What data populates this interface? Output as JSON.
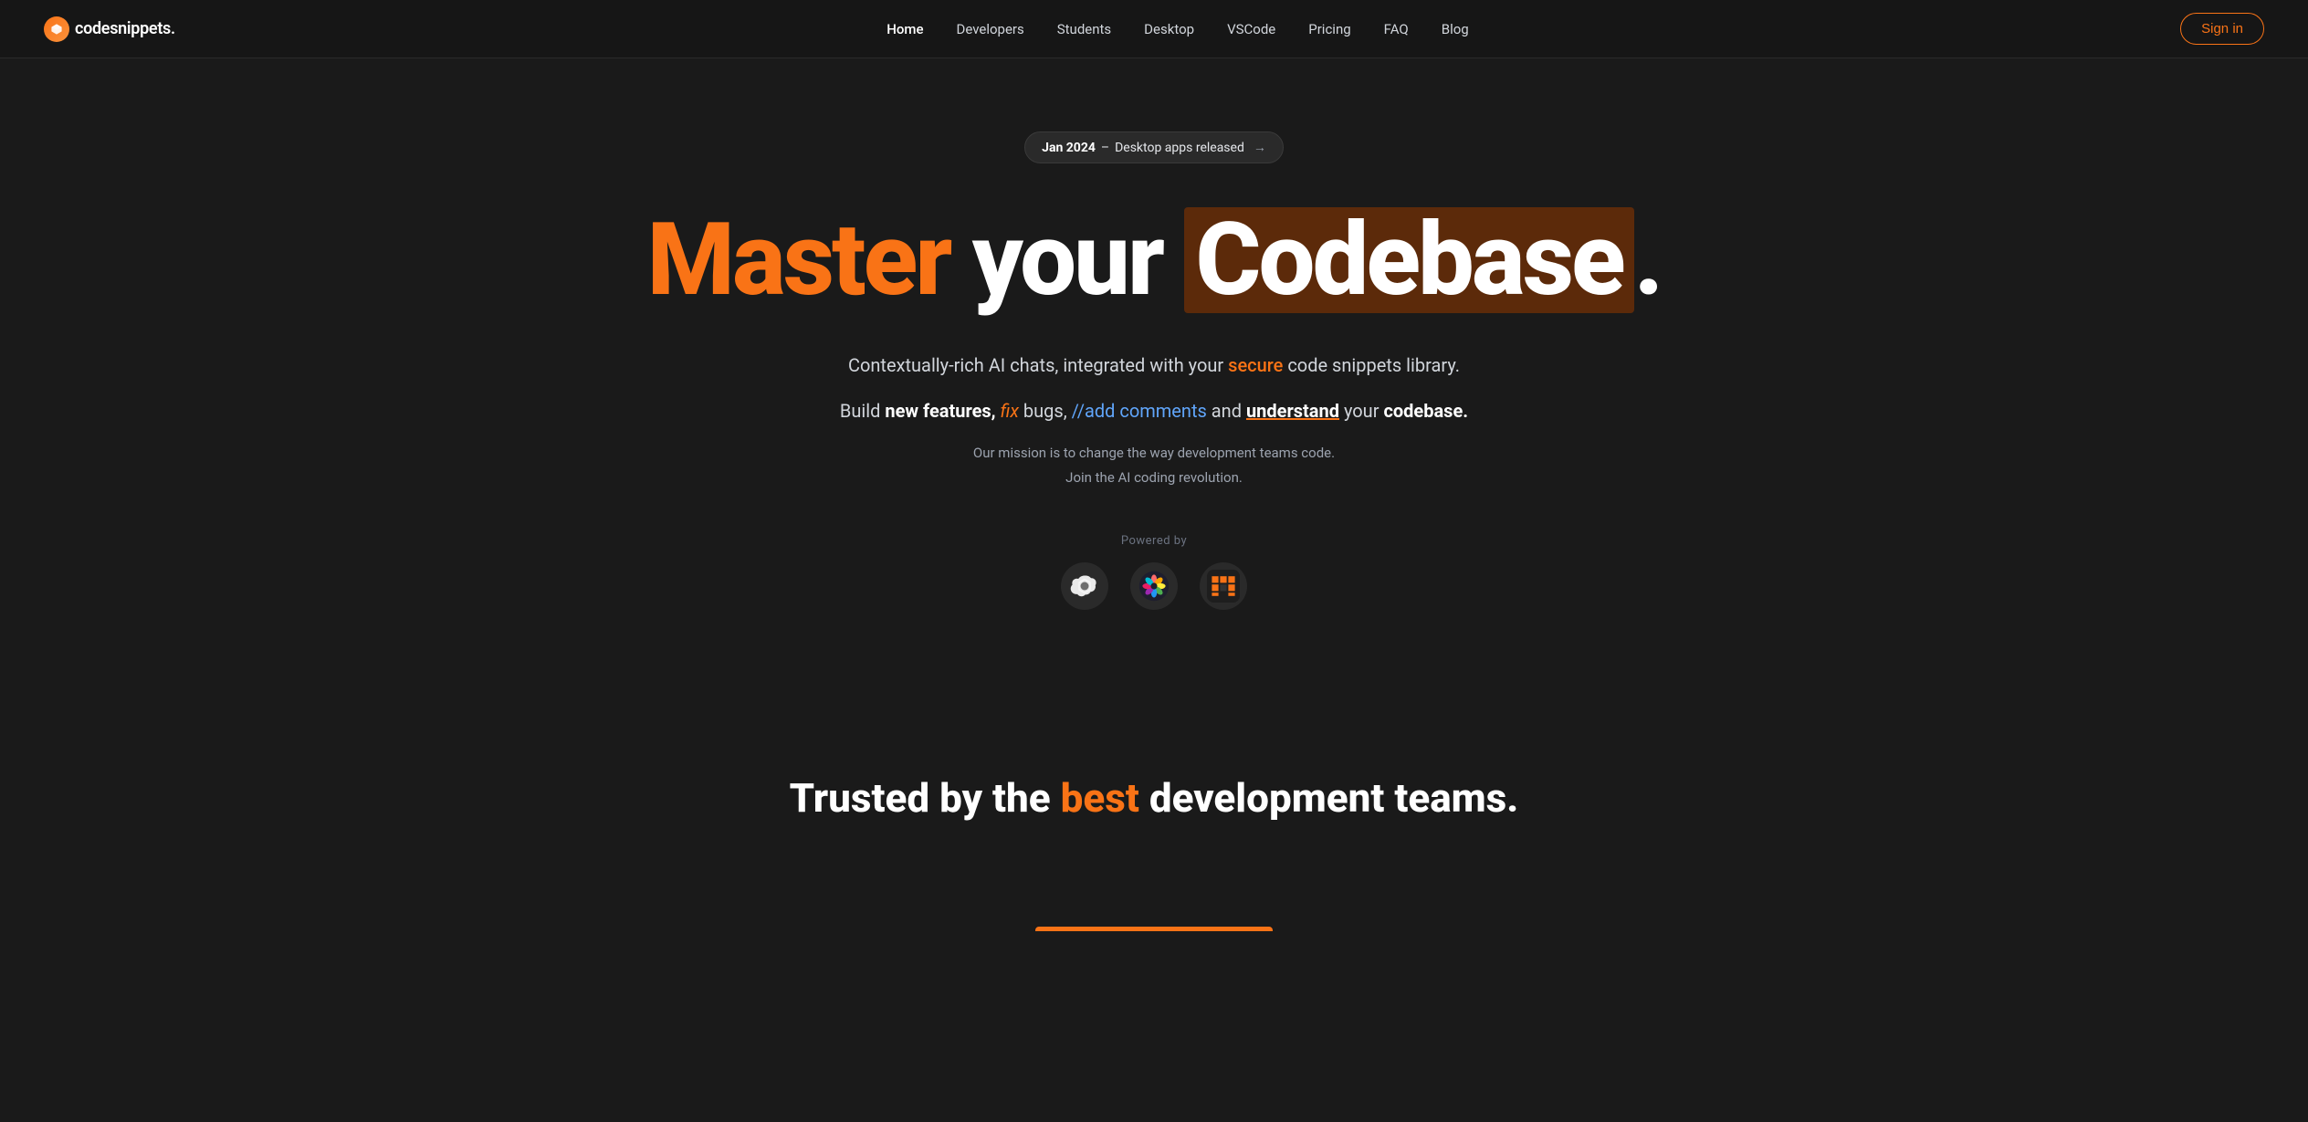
{
  "brand": {
    "name": "codesnippets.",
    "icon_label": "cs-logo-icon"
  },
  "nav": {
    "links": [
      {
        "label": "Home",
        "active": true,
        "id": "home"
      },
      {
        "label": "Developers",
        "active": false,
        "id": "developers"
      },
      {
        "label": "Students",
        "active": false,
        "id": "students"
      },
      {
        "label": "Desktop",
        "active": false,
        "id": "desktop"
      },
      {
        "label": "VSCode",
        "active": false,
        "id": "vscode"
      },
      {
        "label": "Pricing",
        "active": false,
        "id": "pricing"
      },
      {
        "label": "FAQ",
        "active": false,
        "id": "faq"
      },
      {
        "label": "Blog",
        "active": false,
        "id": "blog"
      }
    ],
    "sign_in_label": "Sign in"
  },
  "hero": {
    "badge": {
      "date": "Jan 2024",
      "separator": "–",
      "text": "Desktop apps released",
      "arrow": "→"
    },
    "title": {
      "word1": "Master",
      "word2": "your",
      "word3": "Codebase",
      "period": "."
    },
    "subtitle_line1_pre": "Contextually-rich AI chats, integrated with your",
    "subtitle_line1_highlight": "secure",
    "subtitle_line1_post": "code snippets library.",
    "subtitle_line2_pre": "Build",
    "subtitle_line2_bold1": "new features,",
    "subtitle_line2_fix": " fix",
    "subtitle_line2_mid": " bugs,",
    "subtitle_line2_comment": " //add comments",
    "subtitle_line2_mid2": " and",
    "subtitle_line2_underline": " understand",
    "subtitle_line2_post": " your",
    "subtitle_line2_bold2": " codebase.",
    "mission_line1": "Our mission is to change the way development teams code.",
    "mission_line2": "Join the AI coding revolution.",
    "powered_by_label": "Powered by"
  },
  "trusted": {
    "pre": "Trusted by the",
    "highlight": "best",
    "post": "development teams."
  },
  "colors": {
    "accent": "#f97316",
    "bg": "#1a1a1a",
    "nav_bg": "#161616",
    "codebase_bg": "#5c2a0a"
  }
}
